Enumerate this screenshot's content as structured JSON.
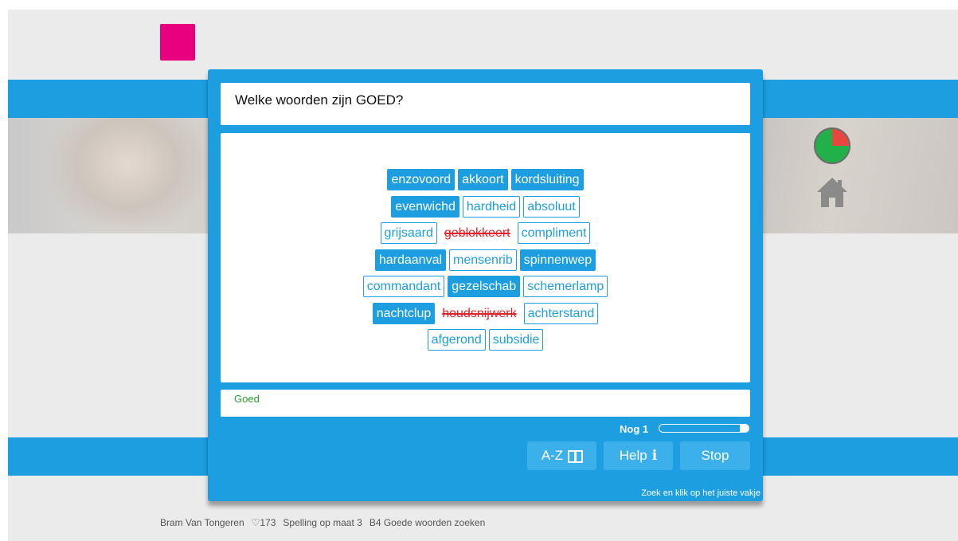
{
  "colors": {
    "accent": "#1c9ee0",
    "brand": "#e8007f",
    "correct": "#2aa12d",
    "wrong": "#e1232b"
  },
  "question": "Welke woorden zijn GOED?",
  "words": [
    [
      {
        "text": "enzovoord",
        "state": "selected"
      },
      {
        "text": "akkoort",
        "state": "selected"
      },
      {
        "text": "kordsluiting",
        "state": "selected"
      }
    ],
    [
      {
        "text": "evenwichd",
        "state": "selected"
      },
      {
        "text": "hardheid",
        "state": "normal"
      },
      {
        "text": "absoluut",
        "state": "normal"
      }
    ],
    [
      {
        "text": "grijsaard",
        "state": "normal"
      },
      {
        "text": "geblokkeert",
        "state": "wrong"
      },
      {
        "text": "compliment",
        "state": "normal"
      }
    ],
    [
      {
        "text": "hardaanval",
        "state": "selected"
      },
      {
        "text": "mensenrib",
        "state": "normal"
      },
      {
        "text": "spinnenwep",
        "state": "selected"
      }
    ],
    [
      {
        "text": "commandant",
        "state": "normal"
      },
      {
        "text": "gezelschab",
        "state": "selected"
      },
      {
        "text": "schemerlamp",
        "state": "normal"
      }
    ],
    [
      {
        "text": "nachtclup",
        "state": "selected"
      },
      {
        "text": "houdsnijwerk",
        "state": "wrong"
      },
      {
        "text": "achterstand",
        "state": "normal"
      }
    ],
    [
      {
        "text": "afgerond",
        "state": "normal"
      },
      {
        "text": "subsidie",
        "state": "normal"
      }
    ]
  ],
  "feedback": "Goed",
  "progress": {
    "label": "Nog 1",
    "fraction": 0.1
  },
  "buttons": {
    "az_label": "A-Z",
    "help_label": "Help",
    "help_icon": "i",
    "stop_label": "Stop"
  },
  "hint": "Zoek en klik op het juiste vakje",
  "score_pie": {
    "red_fraction": 0.25,
    "green_fraction": 0.75
  },
  "footer": {
    "user": "Bram Van Tongeren",
    "hearts": "♡173",
    "course": "Spelling op maat 3",
    "lesson": "B4 Goede woorden zoeken"
  }
}
